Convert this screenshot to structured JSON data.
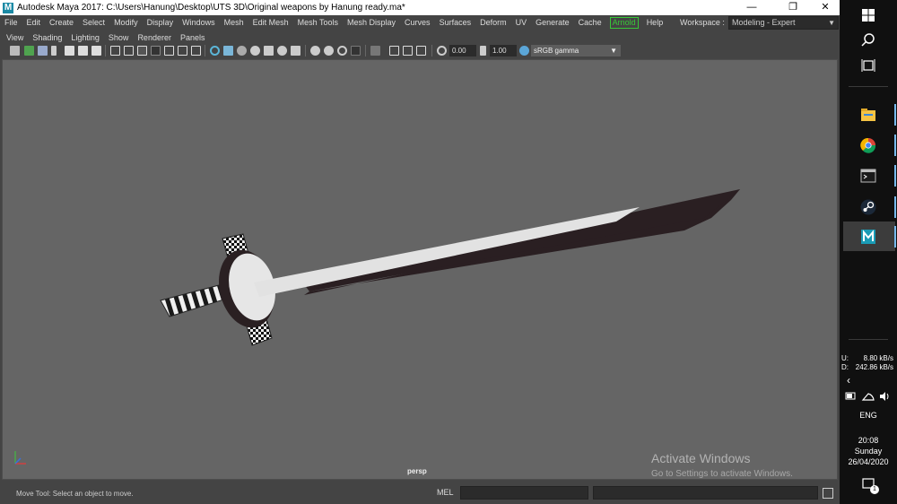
{
  "window": {
    "app_icon": "M",
    "title": "Autodesk Maya 2017: C:\\Users\\Hanung\\Desktop\\UTS 3D\\Original weapons by Hanung ready.ma*",
    "minimize": "—",
    "restore": "❐",
    "close": "✕"
  },
  "menubar": {
    "items": [
      "File",
      "Edit",
      "Create",
      "Select",
      "Modify",
      "Display",
      "Windows",
      "Mesh",
      "Edit Mesh",
      "Mesh Tools",
      "Mesh Display",
      "Curves",
      "Surfaces",
      "Deform",
      "UV",
      "Generate",
      "Cache",
      "Arnold",
      "Help"
    ],
    "workspace_label": "Workspace :",
    "workspace_value": "Modeling - Expert",
    "arnold_color": "#37c837"
  },
  "panel_menu": {
    "items": [
      "View",
      "Shading",
      "Lighting",
      "Show",
      "Renderer",
      "Panels"
    ]
  },
  "panel_toolbar": {
    "exposure": "0.00",
    "gamma": "1.00",
    "color_space": "sRGB gamma"
  },
  "viewport": {
    "camera": "persp",
    "background": "#656565",
    "watermark_title": "Activate Windows",
    "watermark_subtitle": "Go to Settings to activate Windows."
  },
  "statusbar": {
    "help_text": "Move Tool: Select an object to move.",
    "command_language": "MEL"
  },
  "taskbar": {
    "upload_label": "U:",
    "upload_rate": "8.80 kB/s",
    "download_label": "D:",
    "download_rate": "242.86 kB/s",
    "language": "ENG",
    "time": "20:08",
    "day": "Sunday",
    "date": "26/04/2020",
    "notification_count": "1",
    "accent": "#76b9ed"
  }
}
